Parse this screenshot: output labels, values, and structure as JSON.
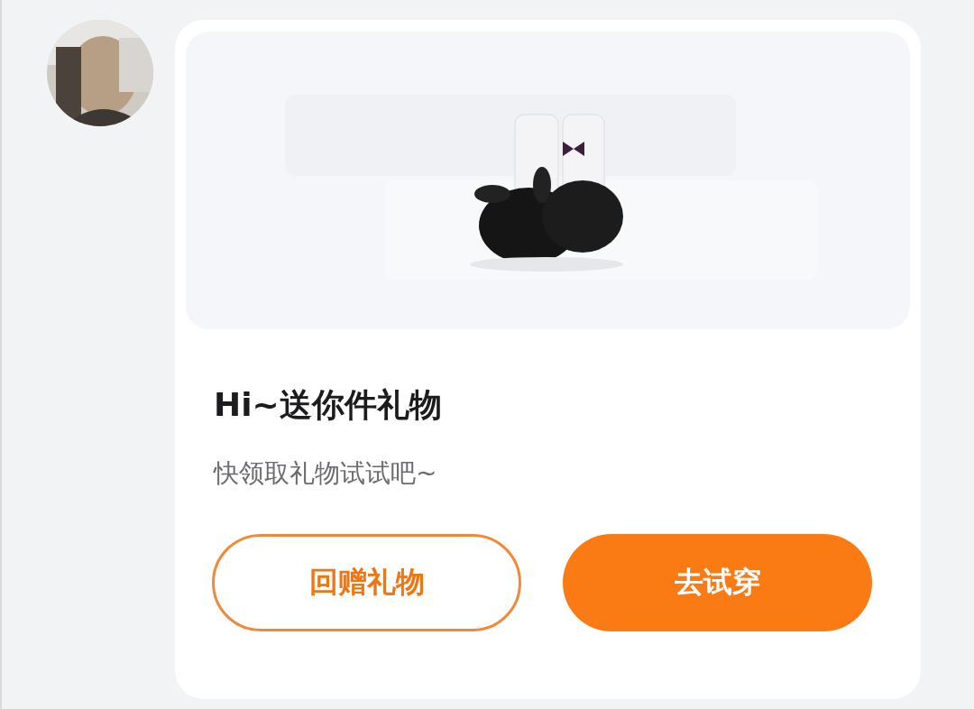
{
  "card": {
    "title": "Hi~送你件礼物",
    "subtitle": "快领取礼物试试吧~",
    "buttons": [
      {
        "label": "回赠礼物",
        "kind": "outline"
      },
      {
        "label": "去试穿",
        "kind": "filled"
      }
    ]
  }
}
